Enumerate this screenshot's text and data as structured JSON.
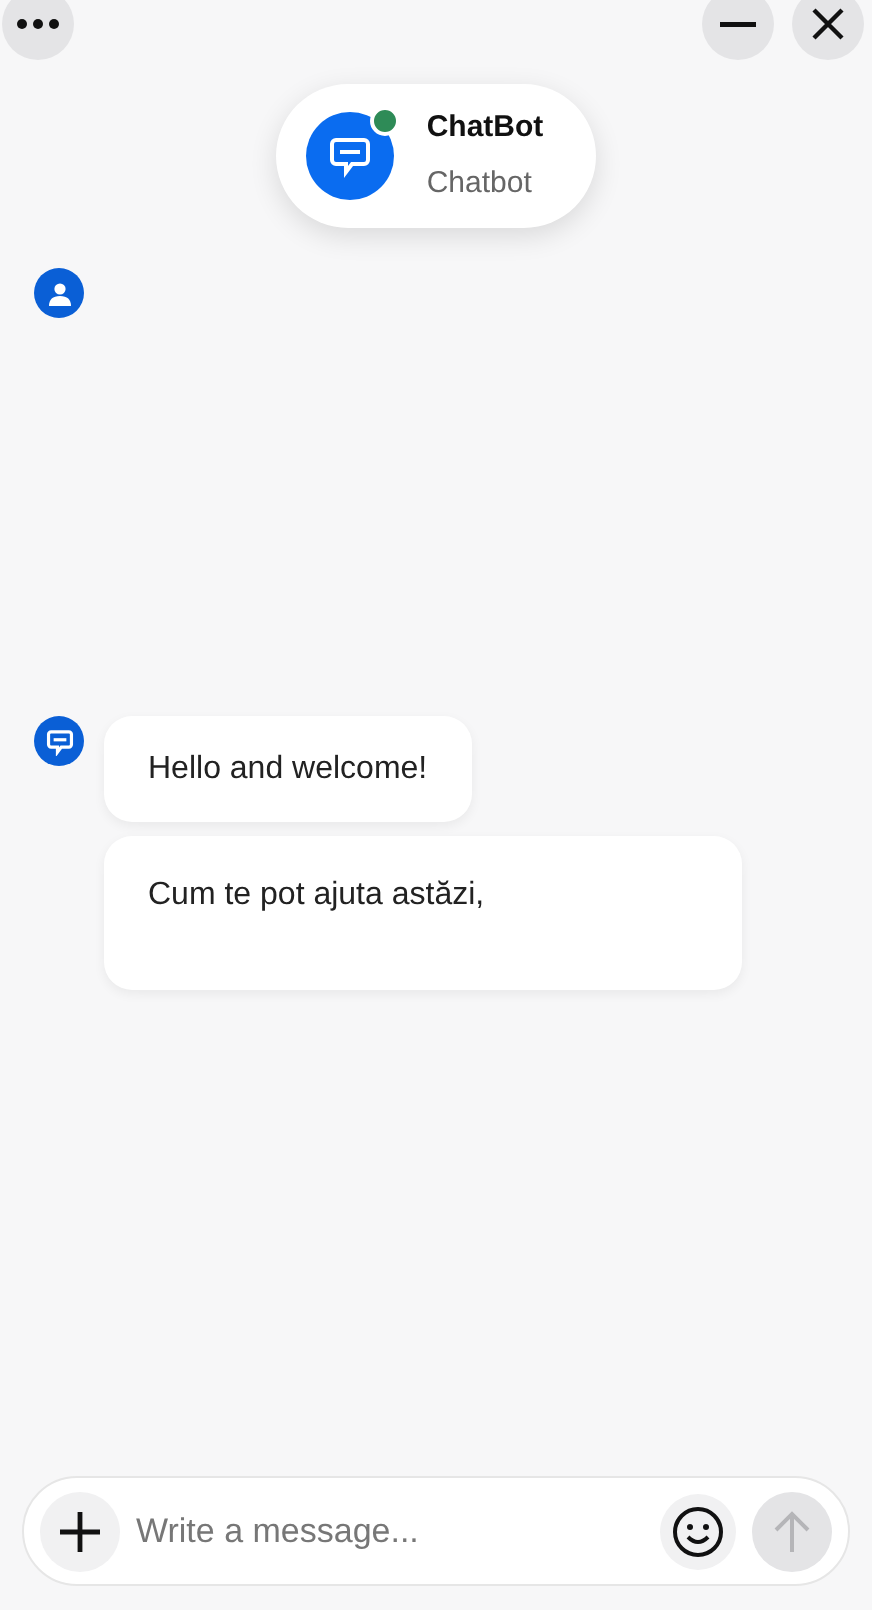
{
  "header": {
    "title": "ChatBot",
    "subtitle": "Chatbot",
    "online": true
  },
  "messages": [
    {
      "kind": "user"
    },
    {
      "kind": "bot",
      "bubbles": [
        "Hello and welcome!",
        "Cum te pot ajuta astăzi,"
      ]
    }
  ],
  "composer": {
    "placeholder": "Write a message...",
    "send_disabled": true
  }
}
